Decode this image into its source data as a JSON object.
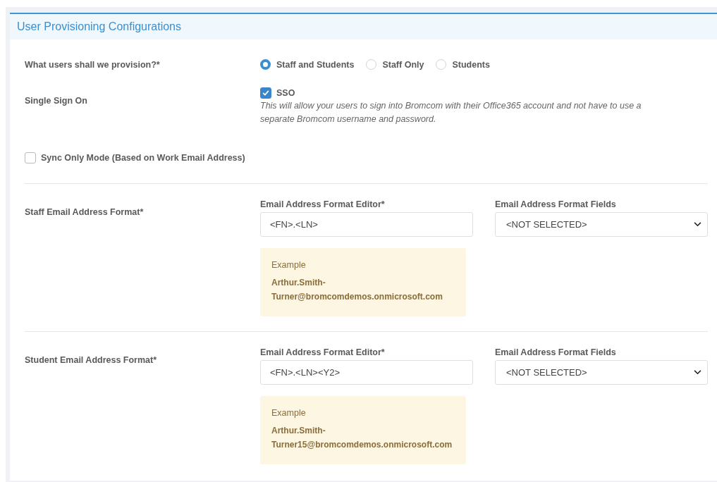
{
  "panel": {
    "title": "User Provisioning Configurations"
  },
  "provision": {
    "label": "What users shall we provision?*",
    "options": [
      {
        "label": "Staff and Students",
        "selected": true
      },
      {
        "label": "Staff Only",
        "selected": false
      },
      {
        "label": "Students",
        "selected": false
      }
    ]
  },
  "sso": {
    "label": "Single Sign On",
    "option": "SSO",
    "checked": true,
    "help": "This will allow your users to sign into Bromcom with their Office365 account and not have to use a separate Bromcom username and password."
  },
  "sync_only": {
    "label": "Sync Only Mode (Based on Work Email Address)",
    "checked": false
  },
  "formats": [
    {
      "label": "Staff Email Address Format*",
      "editor_label": "Email Address Format Editor*",
      "editor_value": "<FN>.<LN>",
      "fields_label": "Email Address Format Fields",
      "fields_value": "<NOT SELECTED>",
      "example_title": "Example",
      "example": "Arthur.Smith-Turner@bromcomdemos.onmicrosoft.com"
    },
    {
      "label": "Student Email Address Format*",
      "editor_label": "Email Address Format Editor*",
      "editor_value": "<FN>.<LN><Y2>",
      "fields_label": "Email Address Format Fields",
      "fields_value": "<NOT SELECTED>",
      "example_title": "Example",
      "example": "Arthur.Smith-Turner15@bromcomdemos.onmicrosoft.com"
    }
  ]
}
